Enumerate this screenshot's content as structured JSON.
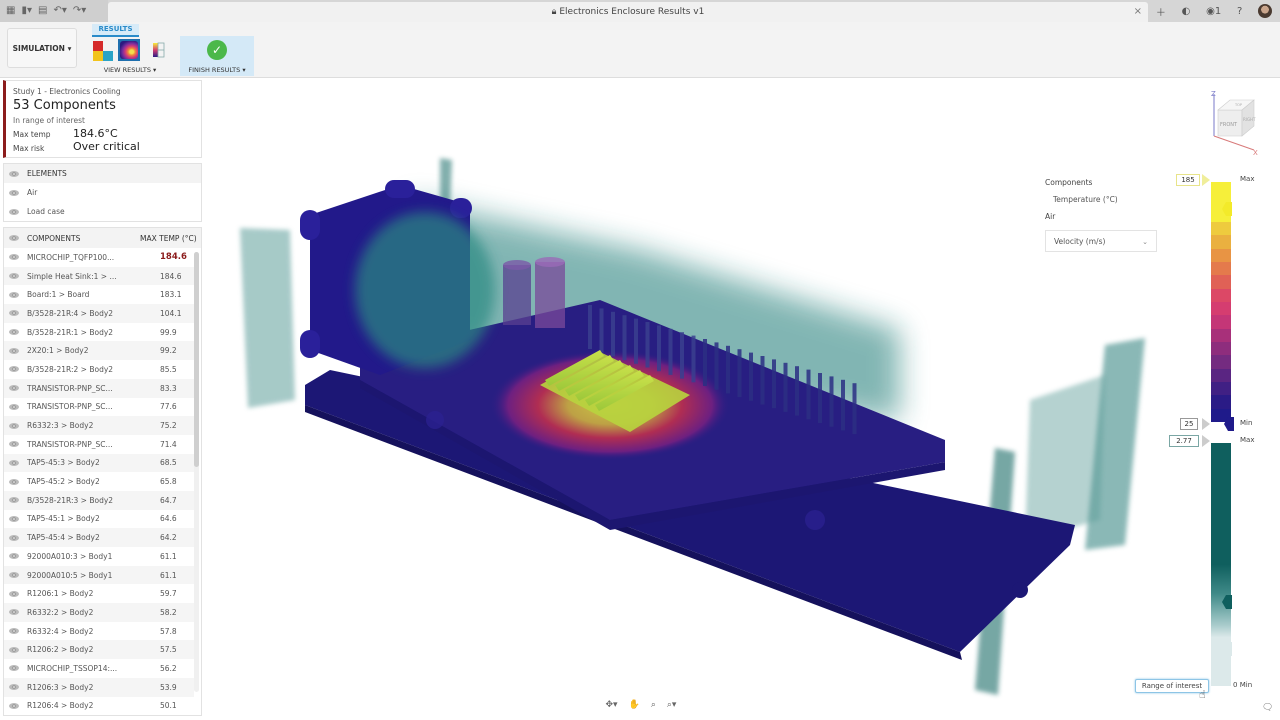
{
  "window": {
    "title": "Electronics Enclosure Results v1",
    "close_icon": "close-icon",
    "left_tools": [
      "grid-icon",
      "file-icon",
      "save-icon",
      "undo-icon",
      "redo-icon"
    ],
    "right_tools": [
      "plus-icon",
      "extensions-icon",
      "job-status-icon",
      "help-icon",
      "avatar"
    ],
    "job_count": "1"
  },
  "ribbon": {
    "workspace_label": "SIMULATION ▾",
    "active_tab": "RESULTS",
    "view_results_label": "VIEW RESULTS ▾",
    "finish_results_label": "FINISH RESULTS ▾"
  },
  "summary": {
    "study": "Study 1 - Electronics Cooling",
    "count": "53 Components",
    "subtitle": "In range of interest",
    "max_temp_label": "Max temp",
    "max_temp_value": "184.6°C",
    "max_risk_label": "Max risk",
    "max_risk_value": "Over critical",
    "accent_color": "#8c1c1c"
  },
  "elements": {
    "header": "ELEMENTS",
    "items": [
      "Air",
      "Load case"
    ]
  },
  "components": {
    "header_name": "COMPONENTS",
    "header_temp": "MAX TEMP (°C)",
    "rows": [
      {
        "name": "MICROCHIP_TQFP100...",
        "temp": "184.6"
      },
      {
        "name": "Simple Heat Sink:1 > ...",
        "temp": "184.6"
      },
      {
        "name": "Board:1 > Board",
        "temp": "183.1"
      },
      {
        "name": "B/3528-21R:4 > Body2",
        "temp": "104.1"
      },
      {
        "name": "B/3528-21R:1 > Body2",
        "temp": "99.9"
      },
      {
        "name": "2X20:1 > Body2",
        "temp": "99.2"
      },
      {
        "name": "B/3528-21R:2 > Body2",
        "temp": "85.5"
      },
      {
        "name": "TRANSISTOR-PNP_SC...",
        "temp": "83.3"
      },
      {
        "name": "TRANSISTOR-PNP_SC...",
        "temp": "77.6"
      },
      {
        "name": "R6332:3 > Body2",
        "temp": "75.2"
      },
      {
        "name": "TRANSISTOR-PNP_SC...",
        "temp": "71.4"
      },
      {
        "name": "TAP5-45:3 > Body2",
        "temp": "68.5"
      },
      {
        "name": "TAP5-45:2 > Body2",
        "temp": "65.8"
      },
      {
        "name": "B/3528-21R:3 > Body2",
        "temp": "64.7"
      },
      {
        "name": "TAP5-45:1 > Body2",
        "temp": "64.6"
      },
      {
        "name": "TAP5-45:4 > Body2",
        "temp": "64.2"
      },
      {
        "name": "92000A010:3 > Body1",
        "temp": "61.1"
      },
      {
        "name": "92000A010:5 > Body1",
        "temp": "61.1"
      },
      {
        "name": "R1206:1 > Body2",
        "temp": "59.7"
      },
      {
        "name": "R6332:2 > Body2",
        "temp": "58.2"
      },
      {
        "name": "R6332:4 > Body2",
        "temp": "57.8"
      },
      {
        "name": "R1206:2 > Body2",
        "temp": "57.5"
      },
      {
        "name": "MICROCHIP_TSSOP14:...",
        "temp": "56.2"
      },
      {
        "name": "R1206:3 > Body2",
        "temp": "53.9"
      },
      {
        "name": "R1206:4 > Body2",
        "temp": "50.1"
      }
    ]
  },
  "legend": {
    "components_label": "Components",
    "temperature_label": "Temperature (°C)",
    "air_label": "Air",
    "air_quantity_selected": "Velocity (m/s)",
    "temp_scale": {
      "max_value": "185",
      "max_label": "Max",
      "min_value": "25",
      "min_label": "Min",
      "colors": [
        "#f6ef3a",
        "#f6ef3a",
        "#f6ef3a",
        "#eecb3e",
        "#eab040",
        "#e89444",
        "#e47a4c",
        "#e06156",
        "#dc4866",
        "#d53d70",
        "#c43677",
        "#a8307a",
        "#8e2d7d",
        "#742b80",
        "#5a2582",
        "#402084",
        "#2a1b86",
        "#1f1a8a"
      ]
    },
    "velocity_scale": {
      "max_value": "2.77",
      "max_label": "Max",
      "min_value": "0",
      "min_label": "Min",
      "range_of_interest_label": "Range of interest"
    }
  },
  "viewcube": {
    "front": "FRONT",
    "right": "RIGHT",
    "top": "TOP",
    "axis_z": "Z",
    "axis_x": "X"
  },
  "navbar": [
    "orbit-icon",
    "pan-icon",
    "zoom-window-icon",
    "zoom-icon"
  ]
}
